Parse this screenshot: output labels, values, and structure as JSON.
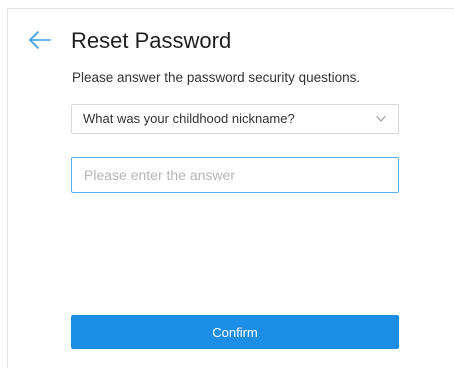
{
  "header": {
    "title": "Reset Password",
    "back_icon": "arrow-left-icon"
  },
  "form": {
    "instruction": "Please answer the password security questions.",
    "question_select": {
      "selected": "What was your childhood nickname?",
      "icon": "chevron-down-icon"
    },
    "answer_input": {
      "value": "",
      "placeholder": "Please enter the answer"
    },
    "confirm_label": "Confirm"
  },
  "colors": {
    "accent": "#1d8ee6",
    "focus_border": "#59b0f0",
    "back_arrow": "#3a9be8"
  }
}
